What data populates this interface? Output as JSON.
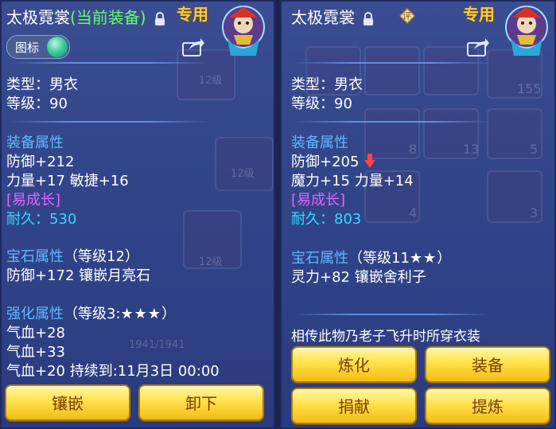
{
  "left": {
    "title_name": "太极霓裳",
    "title_status": "(当前装备)",
    "exclusive_tag": "专用",
    "icon_toggle_label": "图标",
    "type_line": "类型：男衣",
    "level_line": "等级：90",
    "attr_header": "装备属性",
    "attr_lines": [
      "防御+212",
      "力量+17 敏捷+16"
    ],
    "growth_tag": "[易成长]",
    "durability": "耐久：530",
    "gem_header": "宝石属性",
    "gem_level": "（等级12）",
    "gem_line": "防御+172 镶嵌月亮石",
    "enhance_header": "强化属性",
    "enhance_level": "（等级3:",
    "enhance_stars": "★★★",
    "enhance_close": "）",
    "enhance_lines": [
      "气血+28",
      "气血+33",
      "气血+20    持续到:11月3日 00:00"
    ],
    "buttons": [
      "镶嵌",
      "卸下"
    ]
  },
  "right": {
    "title_name": "太极霓裳",
    "rating_badge": "评",
    "exclusive_tag": "专用",
    "type_line": "类型：男衣",
    "level_line": "等级：90",
    "attr_header": "装备属性",
    "attr_line_1": "防御+205",
    "attr_line_2": "魔力+15 力量+14",
    "growth_tag": "[易成长]",
    "durability": "耐久：803",
    "gem_header": "宝石属性",
    "gem_level": "（等级11",
    "gem_stars": "★★",
    "gem_close": "）",
    "gem_line": "灵力+82 镶嵌舍利子",
    "lore": "相传此物乃老子飞升时所穿衣装",
    "buttons": [
      "炼化",
      "装备",
      "捐献",
      "提炼"
    ]
  },
  "background_ghosts": [
    "12级",
    "12级",
    "12级",
    "155",
    "8",
    "13",
    "5",
    "4",
    "3",
    "1941/1941"
  ],
  "colors": {
    "panel_bg": "#33468a",
    "section_blue": "#5fb8ff",
    "growth_pink": "#e066ff",
    "durability_cyan": "#33d9ff",
    "exclusive_gold": "#ffcc33",
    "equipped_green": "#66ff66",
    "button_gold": "#ffe14a",
    "down_arrow_red": "#ff4444"
  },
  "icons": [
    "lock-icon",
    "share-icon",
    "avatar-icon",
    "toggle-knob-icon",
    "down-arrow-icon",
    "rating-badge-icon"
  ]
}
